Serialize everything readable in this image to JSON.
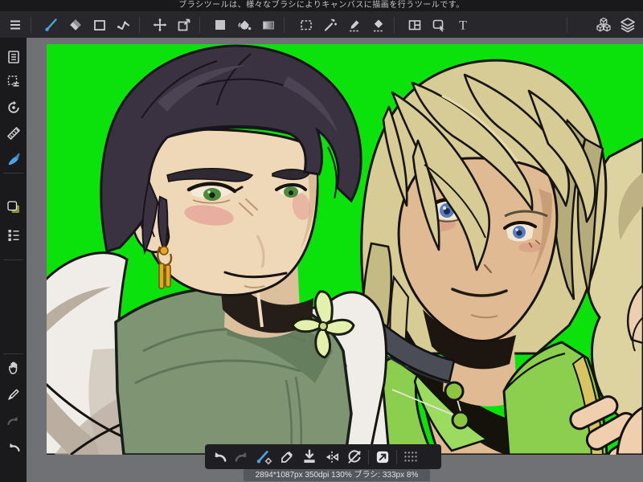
{
  "message_bar": {
    "text": "ブラシツールは、様々なブラシによりキャンバスに描画を行うツールです。"
  },
  "toolbar": {
    "icons": [
      "menu",
      "brush",
      "eraser",
      "rectangle",
      "polyline",
      "move",
      "transform",
      "fill-square",
      "bucket",
      "gradient",
      "select-rectangle",
      "magic-wand",
      "select-pen",
      "select-eraser",
      "divide-canvas",
      "operation-cursor",
      "text",
      "material-cubes",
      "layers"
    ],
    "selected_tool": "brush",
    "text_tool_label": "T"
  },
  "sidebar": {
    "icons": [
      "document-panel",
      "select-layer",
      "rotate-reset",
      "ruler",
      "brush-panel",
      "color-swatch",
      "palette-list",
      "hand",
      "pen",
      "redo",
      "undo"
    ],
    "selected_icon": "brush-panel"
  },
  "floating_toolbar": {
    "icons": [
      "undo",
      "redo",
      "brush-eraser-toggle",
      "eyedropper",
      "save",
      "flip-horizontal",
      "rotate-off",
      "fullscreen-toggle",
      "drag-handle"
    ],
    "active_icon": "brush-eraser-toggle",
    "disabled_icons": [
      "redo"
    ]
  },
  "status_bar": {
    "text": "2894*1087px 350dpi 130% ブラシ: 333px 8%",
    "canvas_size": "2894*1087px",
    "dpi": "350dpi",
    "zoom": "130%",
    "brush_info": "ブラシ: 333px 8%"
  },
  "colors": {
    "accent_blue": "#4ba3e2",
    "canvas_green": "#0be20b",
    "workspace_gray": "#6f7175",
    "toolbar_bg": "#28282c",
    "sidebar_bg": "#1a1a1d",
    "icon_gray": "#cdced2",
    "icon_disabled": "#5c5c60"
  },
  "canvas_art": {
    "background": "chroma green",
    "left_character": {
      "hair": "#3a3240",
      "skin": "#eed8b8",
      "eyes": "#4d8a3e",
      "collar": "#7e9472",
      "jacket": "#f0ede8",
      "earring": "#e7a81e",
      "blush": "#e59390"
    },
    "right_character": {
      "hair": "#d7cc96",
      "skin": "#dfba92",
      "eyes": "#5a7cc0",
      "vest": "#8ccf4e",
      "choker": "#4a4d55",
      "beads": "#8cc53f"
    }
  }
}
